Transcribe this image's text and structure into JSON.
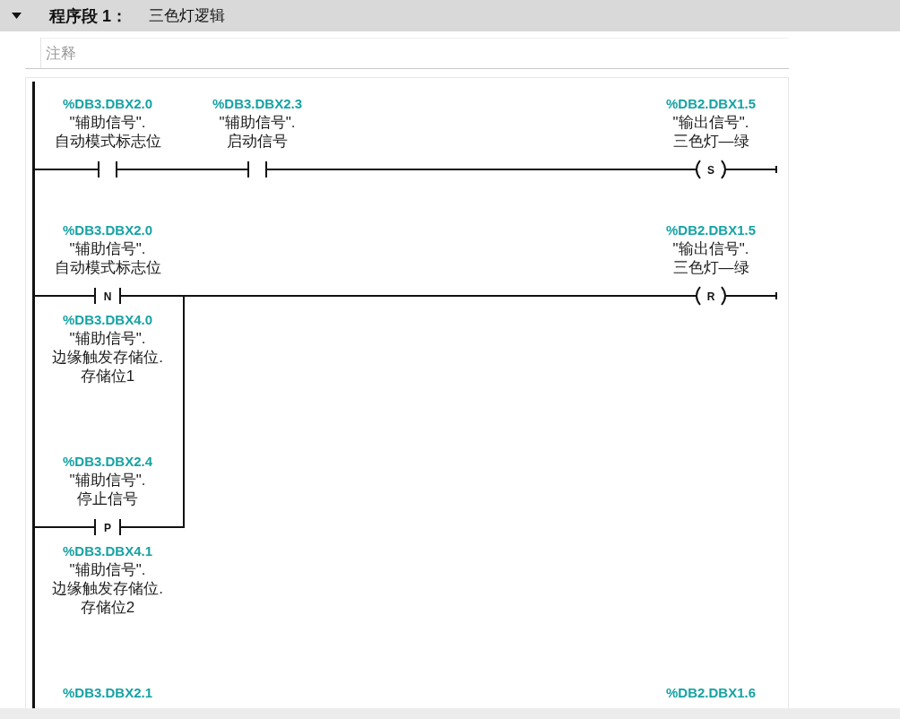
{
  "network": {
    "expanded": true,
    "label": "程序段 1：",
    "title": "三色灯逻辑"
  },
  "comment": {
    "placeholder": "注释"
  },
  "rungs": [
    {
      "rows": [
        {
          "contacts": [
            {
              "kind": "contact",
              "address": "%DB3.DBX2.0",
              "name_lines": [
                "\"辅助信号\".",
                "自动模式标志位"
              ]
            },
            {
              "kind": "contact",
              "address": "%DB3.DBX2.3",
              "name_lines": [
                "\"辅助信号\".",
                "启动信号"
              ]
            }
          ]
        }
      ],
      "coil": {
        "kind": "coil",
        "symbol": "S",
        "address": "%DB2.DBX1.5",
        "name_lines": [
          "\"输出信号\".",
          "三色灯—绿"
        ]
      }
    },
    {
      "rows": [
        {
          "contacts": [
            {
              "kind": "edge_contact",
              "symbol": "N",
              "address": "%DB3.DBX2.0",
              "name_lines": [
                "\"辅助信号\".",
                "自动模式标志位"
              ],
              "memory": {
                "address": "%DB3.DBX4.0",
                "name_lines": [
                  "\"辅助信号\".",
                  "边缘触发存储位.",
                  "存储位1"
                ]
              }
            }
          ]
        },
        {
          "contacts": [
            {
              "kind": "edge_contact",
              "symbol": "P",
              "address": "%DB3.DBX2.4",
              "name_lines": [
                "\"辅助信号\".",
                "停止信号"
              ],
              "memory": {
                "address": "%DB3.DBX4.1",
                "name_lines": [
                  "\"辅助信号\".",
                  "边缘触发存储位.",
                  "存储位2"
                ]
              }
            }
          ]
        }
      ],
      "coil": {
        "kind": "coil",
        "symbol": "R",
        "address": "%DB2.DBX1.5",
        "name_lines": [
          "\"输出信号\".",
          "三色灯—绿"
        ]
      }
    },
    {
      "rows": [
        {
          "contacts": [
            {
              "address": "%DB3.DBX2.1"
            }
          ]
        }
      ],
      "coil": {
        "address": "%DB2.DBX1.6"
      }
    }
  ]
}
